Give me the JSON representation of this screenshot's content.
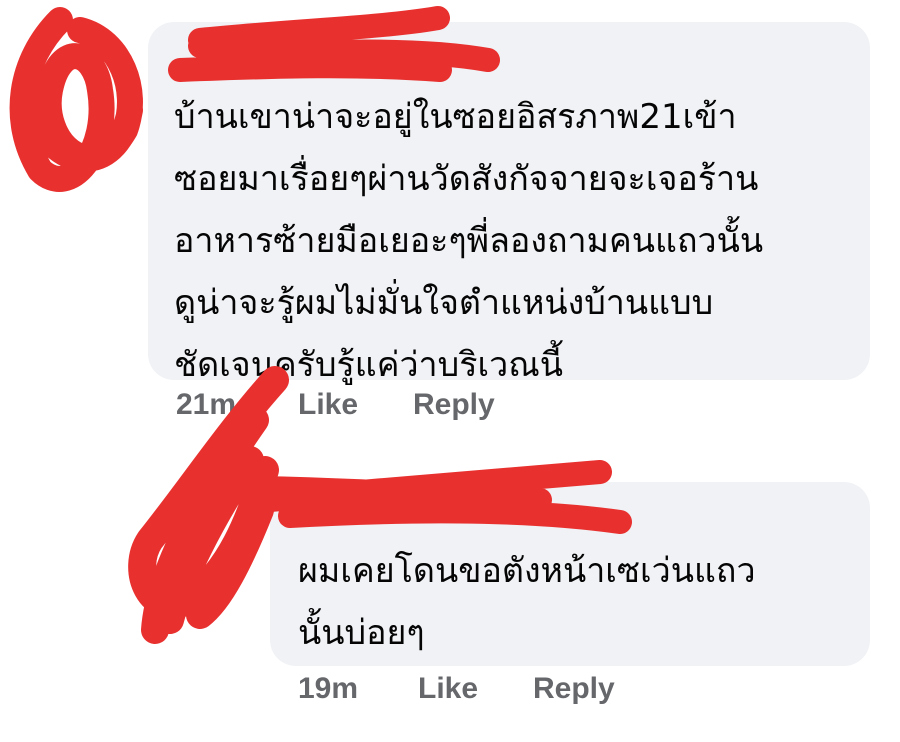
{
  "comments": [
    {
      "author": "",
      "text": "บ้านเขาน่าจะอยู่ในซอยอิสรภาพ21เข้า\nซอยมาเรื่อยๆผ่านวัดสังกัจจายจะเจอร้าน\nอาหารซ้ายมือเยอะๆพี่ลองถามคนแถวนั้น\nดูน่าจะรู้ผมไม่มั่นใจตำแหน่งบ้านแบบ\nชัดเจนครับรู้แค่ว่าบริเวณนี้",
      "time": "21m",
      "like_label": "Like",
      "reply_label": "Reply"
    },
    {
      "author": "",
      "text": "ผมเคยโดนขอตังหน้าเซเว่นแถว\nนั้นบ่อยๆ",
      "time": "19m",
      "like_label": "Like",
      "reply_label": "Reply"
    }
  ],
  "colors": {
    "bubble": "#f0f2f5",
    "text": "#050505",
    "secondary": "#65676b",
    "redaction": "#e8312f"
  }
}
